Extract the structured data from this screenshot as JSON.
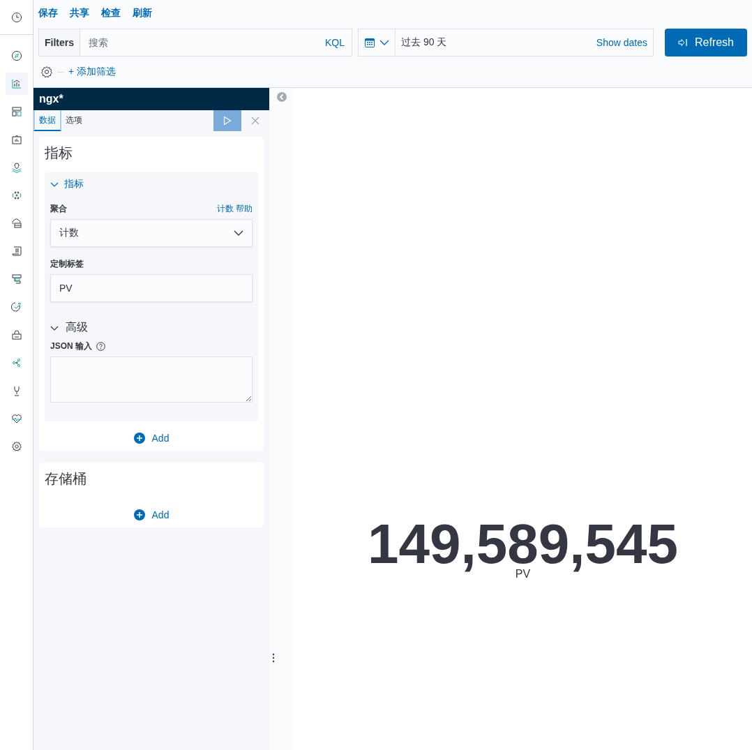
{
  "nav_items": [
    {
      "selected": false
    },
    {
      "selected": false
    },
    {
      "selected": true
    },
    {
      "selected": false
    },
    {
      "selected": false
    },
    {
      "selected": false
    },
    {
      "selected": false
    },
    {
      "selected": false
    },
    {
      "selected": false
    },
    {
      "selected": false
    },
    {
      "selected": false
    },
    {
      "selected": false
    },
    {
      "selected": false
    },
    {
      "selected": false
    },
    {
      "selected": false
    },
    {
      "selected": false
    }
  ],
  "top_menu": [
    "保存",
    "共享",
    "检查",
    "刷新"
  ],
  "query_bar": {
    "filters_label": "Filters",
    "placeholder": "搜索",
    "language": "KQL",
    "date_range": "过去 90 天",
    "show_dates": "Show dates",
    "refresh": "Refresh",
    "add_filter": "+ 添加筛选"
  },
  "editor": {
    "index_pattern": "ngx*",
    "tabs": [
      {
        "label": "数据",
        "selected": true
      },
      {
        "label": "选项",
        "selected": false
      }
    ],
    "metrics_title": "指标",
    "metric": {
      "title": "指标",
      "expanded": true,
      "aggregation_label": "聚合",
      "aggregation_help": "计数 帮助",
      "aggregation": "计数",
      "custom_label_label": "定制标签",
      "custom_label": "PV",
      "advanced": {
        "title": "高级",
        "expanded": true
      },
      "json_label": "JSON 输入"
    },
    "metrics_add": "Add",
    "buckets_title": "存储桶",
    "buckets_add": "Add"
  },
  "visualization": {
    "value": "149,589,545",
    "label": "PV"
  }
}
